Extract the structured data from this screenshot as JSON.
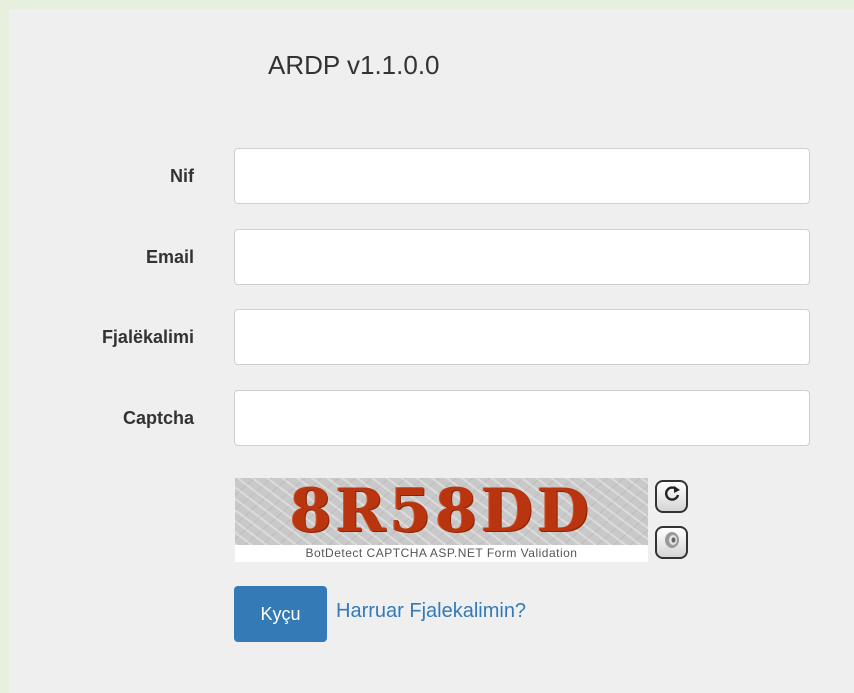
{
  "app": {
    "title": "ARDP v1.1.0.0"
  },
  "form": {
    "nif": {
      "label": "Nif",
      "value": "",
      "placeholder": ""
    },
    "email": {
      "label": "Email",
      "value": "",
      "placeholder": ""
    },
    "password": {
      "label": "Fjalëkalimi",
      "value": "",
      "placeholder": ""
    },
    "captcha": {
      "label": "Captcha",
      "value": "",
      "placeholder": ""
    }
  },
  "captcha_image": {
    "code": "8R58DD",
    "caption": "BotDetect CAPTCHA ASP.NET Form Validation",
    "code_color": "#b8350f",
    "reload_icon": "reload-icon",
    "sound_icon": "speaker-icon"
  },
  "actions": {
    "login_label": "Kyçu",
    "forgot_label": "Harruar Fjalekalimin?",
    "accent_color": "#337ab7"
  }
}
